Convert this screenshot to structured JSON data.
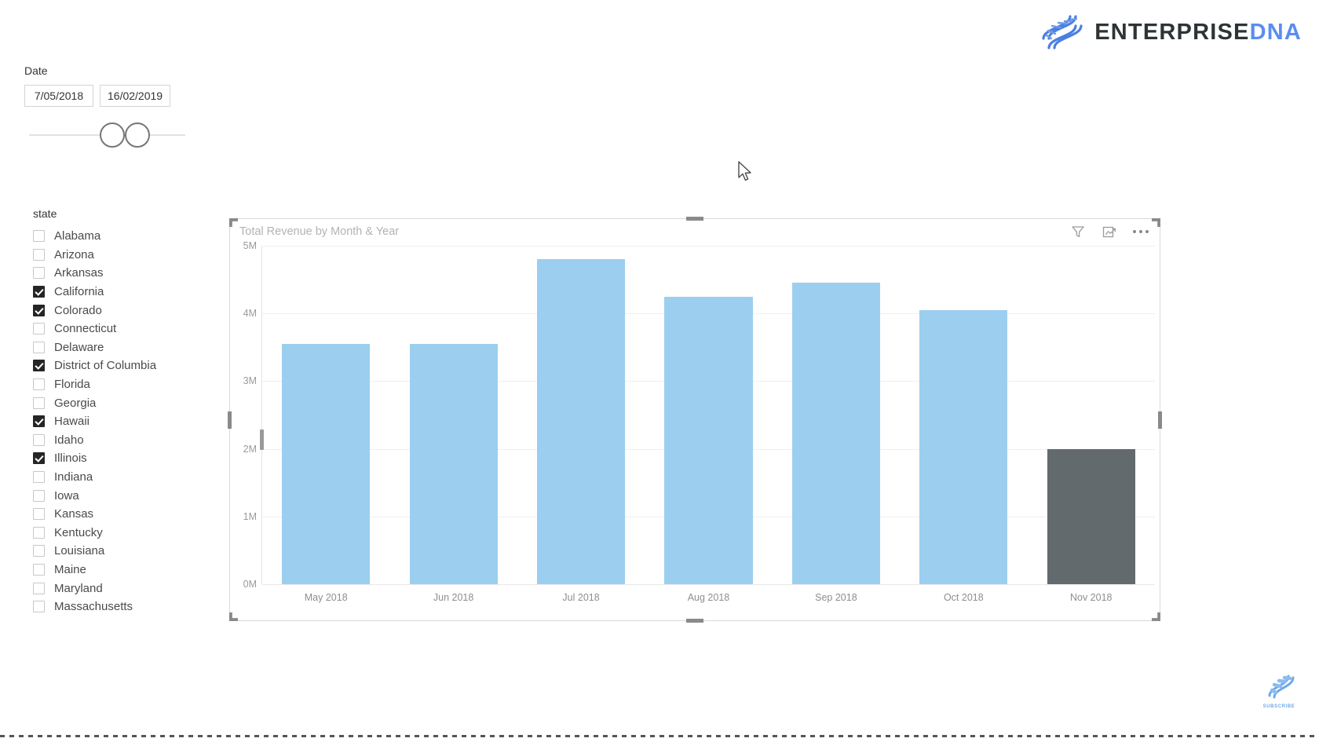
{
  "brand": {
    "name_primary": "ENTERPRISE",
    "name_secondary": "DNA",
    "helix_icon": "dna-helix-icon",
    "primary_color": "#2e3436",
    "secondary_color": "#5b8def"
  },
  "date_slicer": {
    "label": "Date",
    "start_value": "7/05/2018",
    "end_value": "16/02/2019"
  },
  "state_slicer": {
    "title": "state",
    "items": [
      {
        "label": "Alabama",
        "checked": false
      },
      {
        "label": "Arizona",
        "checked": false
      },
      {
        "label": "Arkansas",
        "checked": false
      },
      {
        "label": "California",
        "checked": true
      },
      {
        "label": "Colorado",
        "checked": true
      },
      {
        "label": "Connecticut",
        "checked": false
      },
      {
        "label": "Delaware",
        "checked": false
      },
      {
        "label": "District of Columbia",
        "checked": true
      },
      {
        "label": "Florida",
        "checked": false
      },
      {
        "label": "Georgia",
        "checked": false
      },
      {
        "label": "Hawaii",
        "checked": true
      },
      {
        "label": "Idaho",
        "checked": false
      },
      {
        "label": "Illinois",
        "checked": true
      },
      {
        "label": "Indiana",
        "checked": false
      },
      {
        "label": "Iowa",
        "checked": false
      },
      {
        "label": "Kansas",
        "checked": false
      },
      {
        "label": "Kentucky",
        "checked": false
      },
      {
        "label": "Louisiana",
        "checked": false
      },
      {
        "label": "Maine",
        "checked": false
      },
      {
        "label": "Maryland",
        "checked": false
      },
      {
        "label": "Massachusetts",
        "checked": false
      }
    ]
  },
  "visual": {
    "title": "Total Revenue by Month & Year",
    "icons": [
      {
        "name": "filter-icon",
        "label": "Filters"
      },
      {
        "name": "focus-mode-icon",
        "label": "Focus mode"
      },
      {
        "name": "more-options-icon",
        "label": "More options"
      }
    ]
  },
  "watermark": {
    "label": "SUBSCRIBE",
    "icon": "dna-helix-icon"
  },
  "chart_data": {
    "type": "bar",
    "title": "Total Revenue by Month & Year",
    "xlabel": "",
    "ylabel": "",
    "categories": [
      "May 2018",
      "Jun 2018",
      "Jul 2018",
      "Aug 2018",
      "Sep 2018",
      "Oct 2018",
      "Nov 2018"
    ],
    "values": [
      3.55,
      3.55,
      4.8,
      4.25,
      4.45,
      4.05,
      2.0
    ],
    "value_unit": "M",
    "ylim": [
      0,
      5
    ],
    "ytick_labels": [
      "0M",
      "1M",
      "2M",
      "3M",
      "4M",
      "5M"
    ],
    "ytick_values": [
      0,
      1,
      2,
      3,
      4,
      5
    ],
    "grid": true,
    "legend": "none",
    "bar_color": "#9ccef0",
    "highlight_color": "#626a6e",
    "highlighted_category": "Nov 2018"
  }
}
